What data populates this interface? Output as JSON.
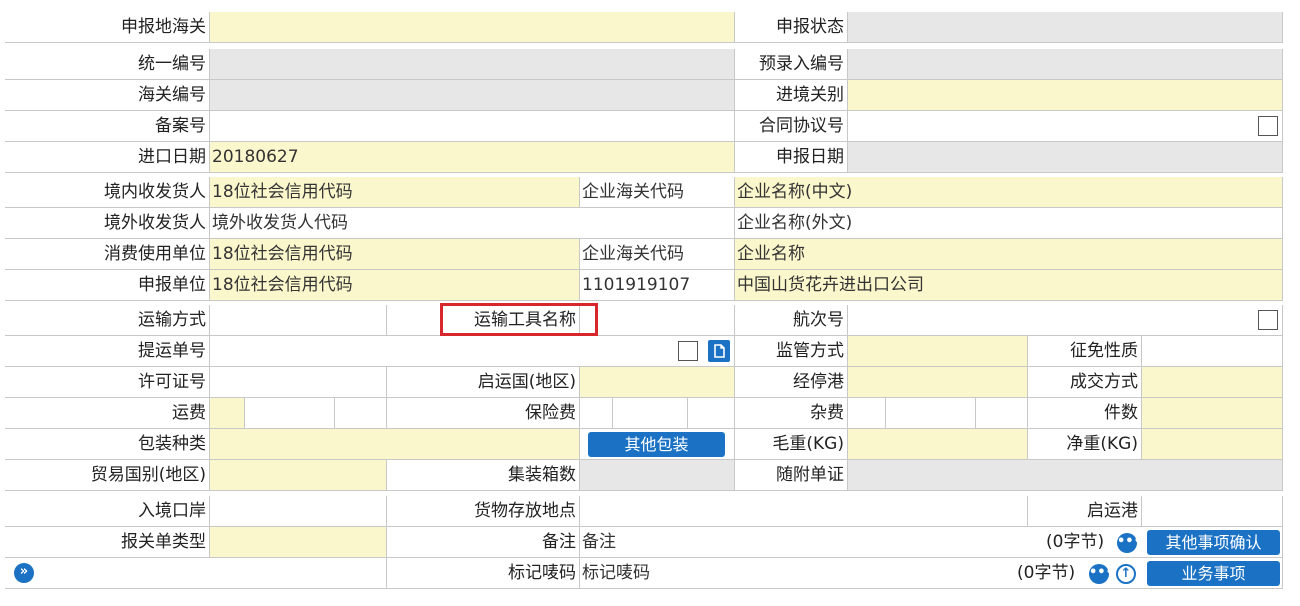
{
  "labels": {
    "declare_customs": "申报地海关",
    "declare_status": "申报状态",
    "unified_no": "统一编号",
    "pre_entry_no": "预录入编号",
    "customs_no": "海关编号",
    "entry_exit_office": "进境关别",
    "record_no": "备案号",
    "contract_no": "合同协议号",
    "import_date": "进口日期",
    "declare_date": "申报日期",
    "domestic_consignee": "境内收发货人",
    "foreign_consignee": "境外收发货人",
    "consumer_unit": "消费使用单位",
    "declaring_unit": "申报单位",
    "transport_mode": "运输方式",
    "transport_tool_name": "运输工具名称",
    "voyage_no": "航次号",
    "bill_no": "提运单号",
    "supervision_mode": "监管方式",
    "levy_nature": "征免性质",
    "license_no": "许可证号",
    "departure_country": "启运国(地区)",
    "transit_port": "经停港",
    "transaction_mode": "成交方式",
    "freight": "运费",
    "insurance": "保险费",
    "misc_fee": "杂费",
    "pieces": "件数",
    "package_type": "包装种类",
    "gross_weight": "毛重(KG)",
    "net_weight": "净重(KG)",
    "trade_country": "贸易国别(地区)",
    "container_count": "集装箱数",
    "attached_docs": "随附单证",
    "entry_port": "入境口岸",
    "goods_location": "货物存放地点",
    "departure_port": "启运港",
    "declaration_type": "报关单类型",
    "remarks": "备注",
    "marks": "标记唛码",
    "enterprise_customs_code": "企业海关代码"
  },
  "values": {
    "import_date": "20180627",
    "domestic_credit": "18位社会信用代码",
    "domestic_name_cn": "企业名称(中文)",
    "foreign_code": "境外收发货人代码",
    "foreign_name": "企业名称(外文)",
    "consumer_credit": "18位社会信用代码",
    "consumer_name": "企业名称",
    "declaring_credit": "18位社会信用代码",
    "declaring_code": "1101919107",
    "declaring_name": "中国山货花卉进出口公司",
    "remarks": "备注",
    "marks": "标记唛码",
    "remarks_bytes": "(0字节)",
    "marks_bytes": "(0字节)"
  },
  "buttons": {
    "other_packaging": "其他包装",
    "other_items_confirm": "其他事项确认",
    "business_items": "业务事项"
  },
  "icons": {
    "expand": "»",
    "more": "•••",
    "up": "↑"
  }
}
